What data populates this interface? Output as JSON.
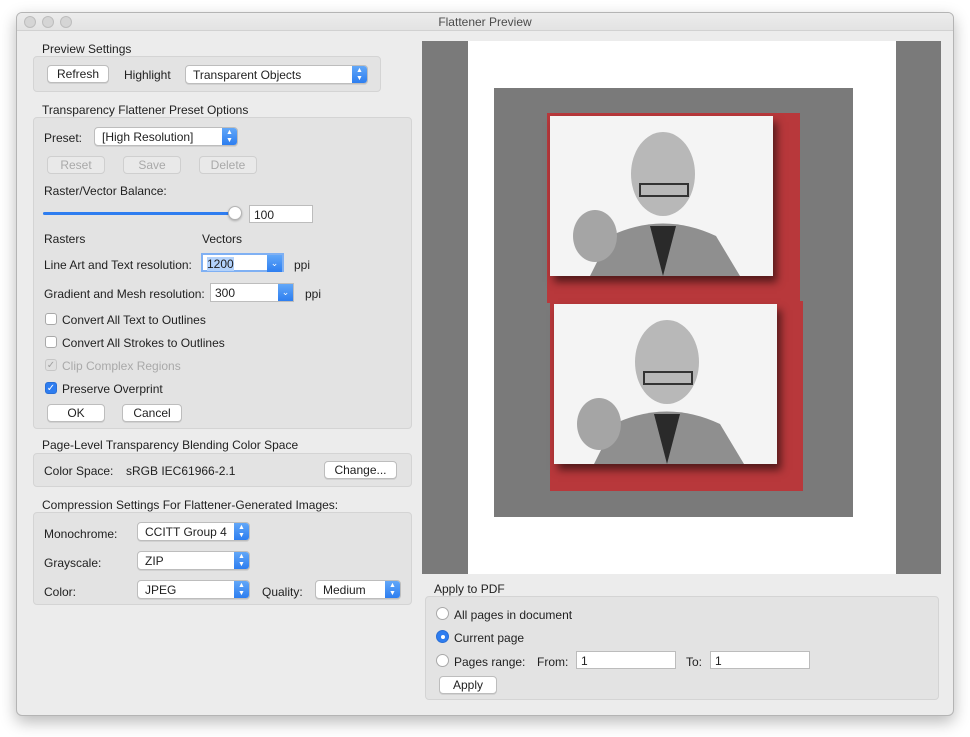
{
  "window": {
    "title": "Flattener Preview"
  },
  "preview_settings": {
    "heading": "Preview Settings",
    "refresh_label": "Refresh",
    "highlight_label": "Highlight",
    "highlight_value": "Transparent Objects"
  },
  "preset_options": {
    "heading": "Transparency Flattener Preset Options",
    "preset_label": "Preset:",
    "preset_value": "[High Resolution]",
    "reset_label": "Reset",
    "save_label": "Save",
    "delete_label": "Delete",
    "balance_label": "Raster/Vector Balance:",
    "balance_value": "100",
    "balance_level": 100,
    "rasters_label": "Rasters",
    "vectors_label": "Vectors",
    "line_art_label": "Line Art and Text resolution:",
    "line_art_value": "1200",
    "line_art_unit": "ppi",
    "gradient_label": "Gradient and Mesh resolution:",
    "gradient_value": "300",
    "gradient_unit": "ppi",
    "options": [
      {
        "label": "Convert All Text to Outlines",
        "checked": false,
        "enabled": true
      },
      {
        "label": "Convert All Strokes to Outlines",
        "checked": false,
        "enabled": true
      },
      {
        "label": "Clip Complex Regions",
        "checked": true,
        "enabled": false
      },
      {
        "label": "Preserve Overprint",
        "checked": true,
        "enabled": true
      }
    ],
    "ok_label": "OK",
    "cancel_label": "Cancel"
  },
  "blending": {
    "heading": "Page-Level Transparency Blending Color Space",
    "color_space_label": "Color Space:",
    "color_space_value": "sRGB IEC61966-2.1",
    "change_label": "Change..."
  },
  "compression": {
    "heading": "Compression Settings For Flattener-Generated Images:",
    "monochrome_label": "Monochrome:",
    "monochrome_value": "CCITT Group 4",
    "grayscale_label": "Grayscale:",
    "grayscale_value": "ZIP",
    "color_label": "Color:",
    "color_value": "JPEG",
    "quality_label": "Quality:",
    "quality_value": "Medium"
  },
  "apply_to_pdf": {
    "heading": "Apply to PDF",
    "all_pages_label": "All pages in document",
    "current_page_label": "Current page",
    "pages_range_label": "Pages range:",
    "selected": "current_page",
    "from_label": "From:",
    "from_value": "1",
    "to_label": "To:",
    "to_value": "1",
    "apply_label": "Apply"
  },
  "colors": {
    "accent": "#2e7df0",
    "highlight_red": "#b8383b",
    "preview_gray": "#7a7a7a"
  }
}
